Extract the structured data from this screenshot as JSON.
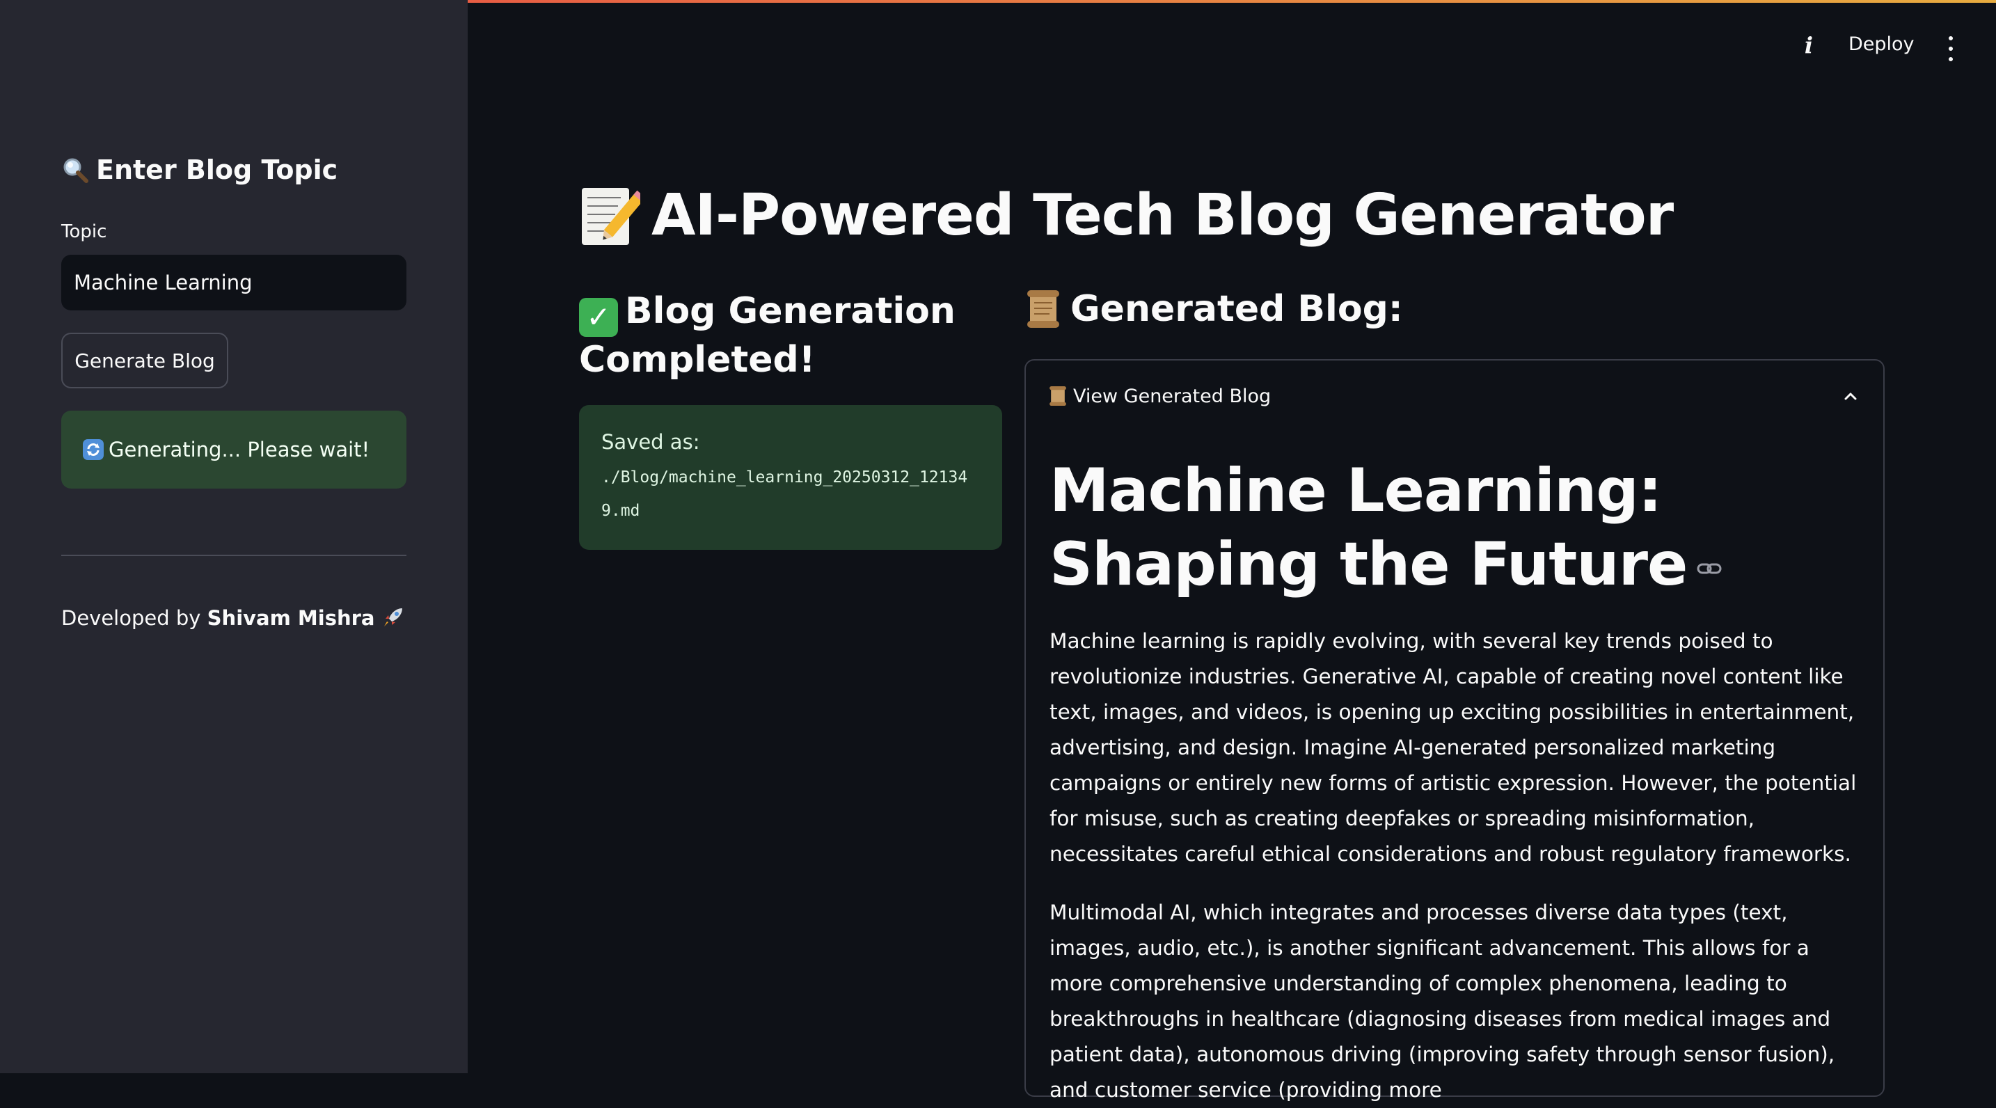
{
  "sidebar": {
    "heading": "Enter Blog Topic",
    "topic_label": "Topic",
    "topic_value": "Machine Learning",
    "generate_button": "Generate Blog",
    "status_text": "Generating... Please wait!",
    "footer_prefix": "Developed by ",
    "footer_author": "Shivam Mishra"
  },
  "header": {
    "info_label": "i",
    "deploy_label": "Deploy"
  },
  "main": {
    "title": "AI-Powered Tech Blog Generator",
    "completed_heading": "Blog Generation Completed!",
    "saved_label": "Saved as:",
    "saved_path": "./Blog/machine_learning_20250312_121349.md",
    "generated_heading": "Generated Blog:",
    "expander_label": "View Generated Blog",
    "blog_title": "Machine Learning: Shaping the Future",
    "paragraphs": [
      "Machine learning is rapidly evolving, with several key trends poised to revolutionize industries. Generative AI, capable of creating novel content like text, images, and videos, is opening up exciting possibilities in entertainment, advertising, and design. Imagine AI-generated personalized marketing campaigns or entirely new forms of artistic expression. However, the potential for misuse, such as creating deepfakes or spreading misinformation, necessitates careful ethical considerations and robust regulatory frameworks.",
      "Multimodal AI, which integrates and processes diverse data types (text, images, audio, etc.), is another significant advancement. This allows for a more comprehensive understanding of complex phenomena, leading to breakthroughs in healthcare (diagnosing diseases from medical images and patient data), autonomous driving (improving safety through sensor fusion), and customer service (providing more"
    ]
  },
  "colors": {
    "background": "#0e1117",
    "sidebar": "#262730",
    "success_box": "#213c2a",
    "info_box": "#2b4731"
  },
  "icons": [
    "magnifier-icon",
    "refresh-icon",
    "rocket-icon",
    "memo-icon",
    "check-icon",
    "scroll-icon",
    "chevron-up-icon",
    "link-icon",
    "kebab-menu-icon"
  ]
}
